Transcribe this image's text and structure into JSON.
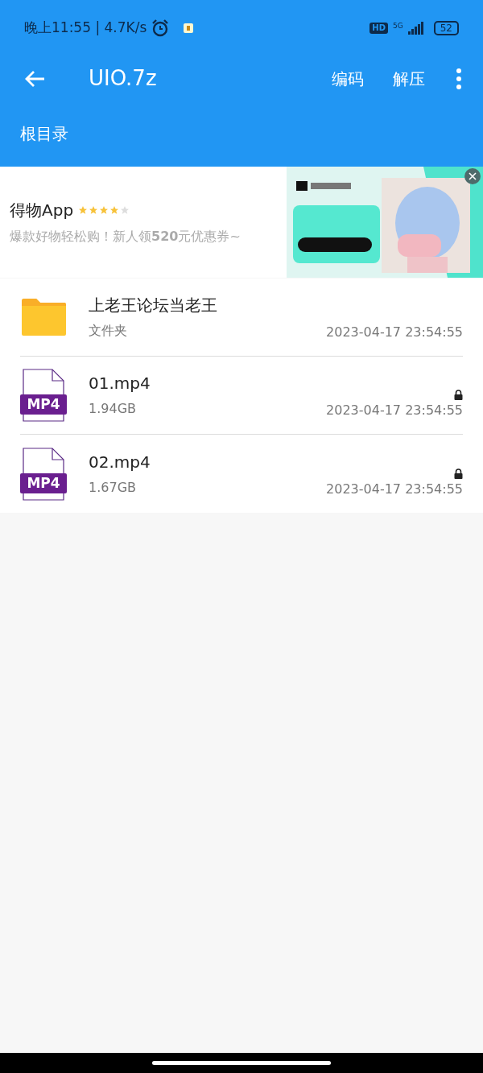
{
  "status_bar": {
    "time": "晚上11:55 | 4.7K/s",
    "hd": "HD",
    "network": "5G",
    "battery": "52"
  },
  "toolbar": {
    "title": "UIO.7z",
    "actions": [
      "编码",
      "解压"
    ]
  },
  "breadcrumb": "根目录",
  "ad": {
    "title": "得物App",
    "stars": 4,
    "description": "爆款好物轻松购！新人领**520**元优惠券~"
  },
  "files": [
    {
      "kind": "folder",
      "name": "上老王论坛当老王",
      "meta": "文件夹",
      "date": "2023-04-17 23:54:55",
      "locked": false
    },
    {
      "kind": "mp4",
      "badge": "MP4",
      "name": "01.mp4",
      "meta": "1.94GB",
      "date": "2023-04-17 23:54:55",
      "locked": true
    },
    {
      "kind": "mp4",
      "badge": "MP4",
      "name": "02.mp4",
      "meta": "1.67GB",
      "date": "2023-04-17 23:54:55",
      "locked": true
    }
  ]
}
